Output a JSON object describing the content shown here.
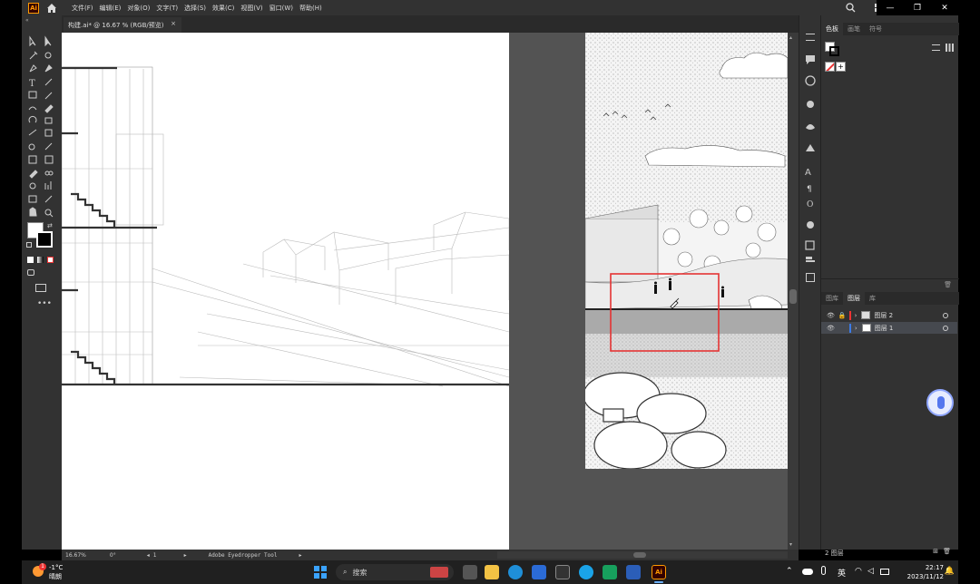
{
  "menubar": {
    "app_badge": "Ai",
    "items": [
      "文件(F)",
      "编辑(E)",
      "对象(O)",
      "文字(T)",
      "选择(S)",
      "效果(C)",
      "视图(V)",
      "窗口(W)",
      "帮助(H)"
    ]
  },
  "document_tab": {
    "title": "构建.ai* @ 16.67 % (RGB/预览)",
    "close": "×"
  },
  "panels": {
    "top_tabs": [
      "色板",
      "画笔",
      "符号"
    ],
    "layers_tabs": [
      "图库",
      "图层",
      "库"
    ],
    "layers": [
      {
        "name": "图层 2",
        "selected": false
      },
      {
        "name": "图层 1",
        "selected": true
      }
    ],
    "layers_count": "2 图层"
  },
  "statusbar": {
    "zoom": "16.67%",
    "rotation": "0°",
    "artboard": "1",
    "tool_name": "Adobe Eyedropper Tool"
  },
  "taskbar": {
    "weather_temp": "-1°C",
    "weather_desc": "晴朗",
    "search_placeholder": "搜索",
    "lang": "英",
    "time": "22:17",
    "date": "2023/11/12",
    "notification_badge": "1"
  },
  "colors": {
    "accent_red": "#e53333",
    "ai_orange": "#ff9a00",
    "panel_bg": "#323232",
    "canvas_bg": "#535353"
  }
}
